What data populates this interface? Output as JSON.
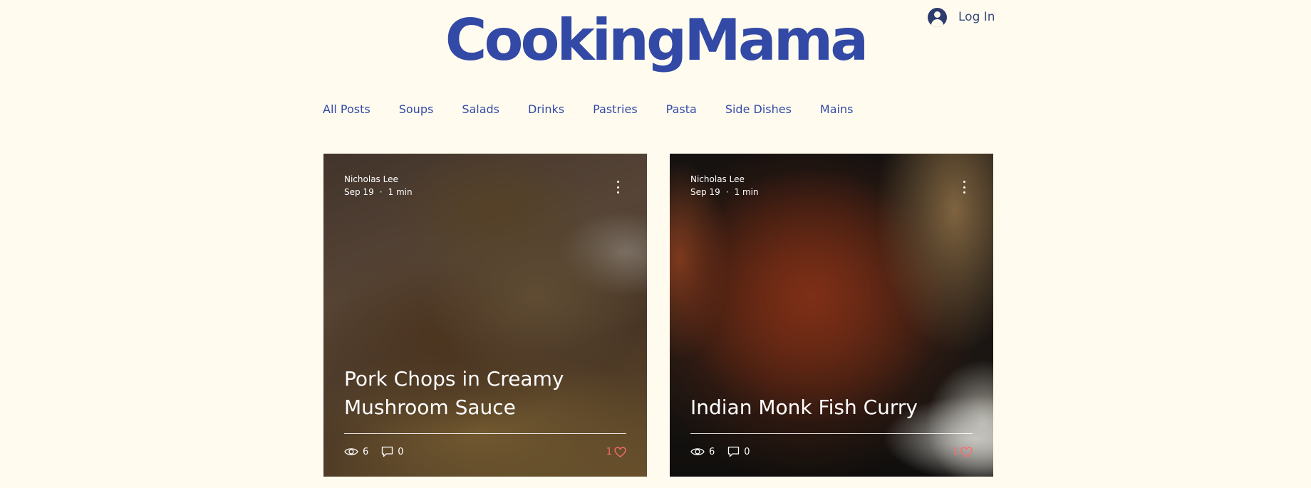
{
  "header": {
    "site_title": "CookingMama",
    "login_label": "Log In"
  },
  "nav": {
    "items": [
      "All Posts",
      "Soups",
      "Salads",
      "Drinks",
      "Pastries",
      "Pasta",
      "Side Dishes",
      "Mains"
    ]
  },
  "posts": [
    {
      "author": "Nicholas Lee",
      "date": "Sep 19",
      "read_time": "1 min",
      "title": "Pork Chops in Creamy Mushroom Sauce",
      "views": "6",
      "comments": "0",
      "likes": "1"
    },
    {
      "author": "Nicholas Lee",
      "date": "Sep 19",
      "read_time": "1 min",
      "title": "Indian Monk Fish Curry",
      "views": "6",
      "comments": "0",
      "likes": "1"
    }
  ],
  "colors": {
    "background": "#fffcef",
    "brand": "#3349a6",
    "like": "#ff6b6b"
  }
}
